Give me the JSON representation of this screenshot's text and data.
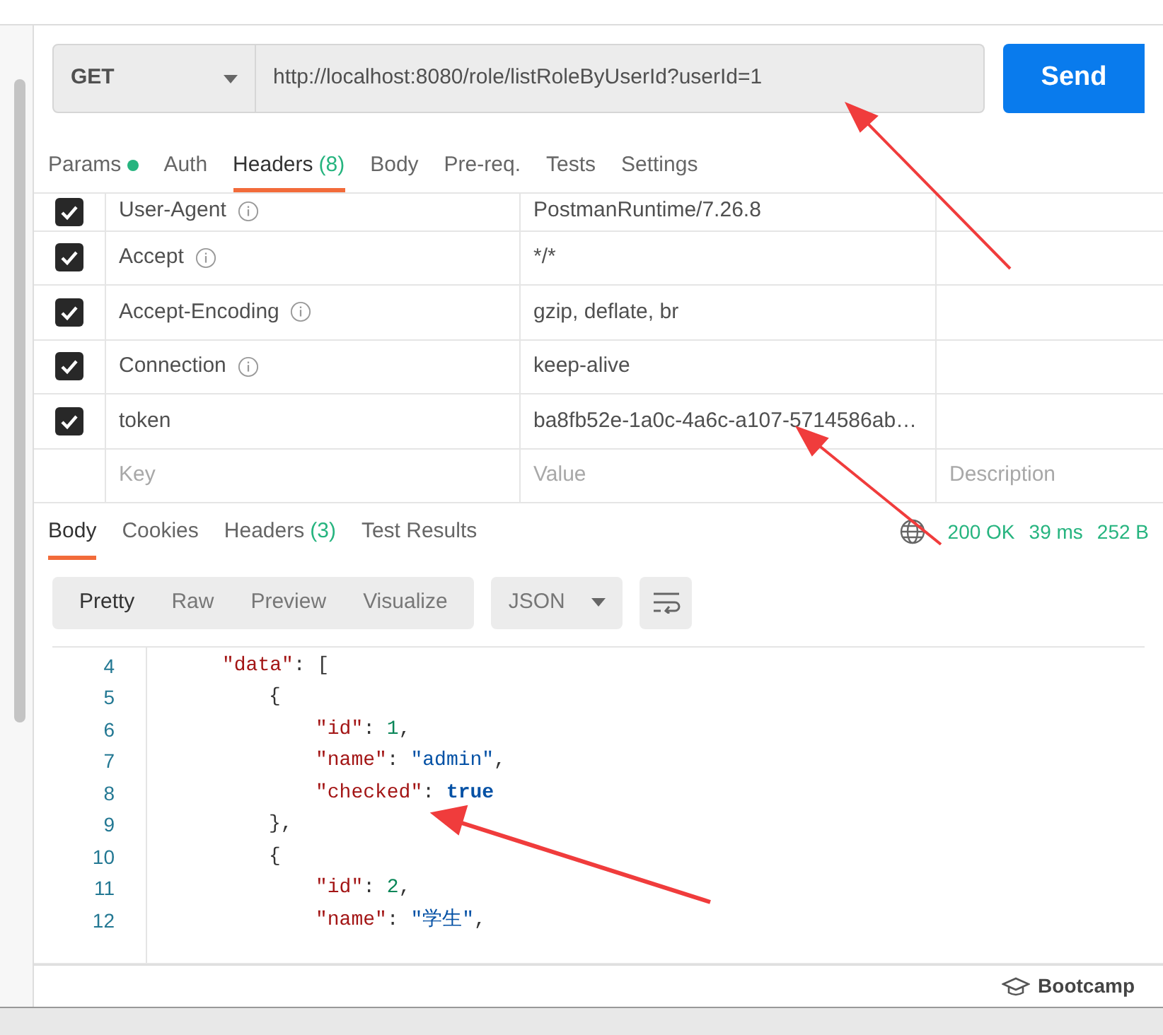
{
  "request": {
    "method": "GET",
    "url": "http://localhost:8080/role/listRoleByUserId?userId=1",
    "send": "Send"
  },
  "request_tabs": [
    {
      "label": "Params",
      "dot": true,
      "selected": false
    },
    {
      "label": "Auth",
      "selected": false
    },
    {
      "label": "Headers",
      "count": "(8)",
      "selected": true
    },
    {
      "label": "Body",
      "selected": false
    },
    {
      "label": "Pre-req.",
      "selected": false
    },
    {
      "label": "Tests",
      "selected": false
    },
    {
      "label": "Settings",
      "selected": false
    }
  ],
  "headers": [
    {
      "key": "User-Agent",
      "value": "PostmanRuntime/7.26.8",
      "checked": true,
      "info": true
    },
    {
      "key": "Accept",
      "value": "*/*",
      "checked": true,
      "info": true
    },
    {
      "key": "Accept-Encoding",
      "value": "gzip, deflate, br",
      "checked": true,
      "info": true
    },
    {
      "key": "Connection",
      "value": "keep-alive",
      "checked": true,
      "info": true
    },
    {
      "key": "token",
      "value": "ba8fb52e-1a0c-4a6c-a107-5714586ab…",
      "checked": true,
      "info": false
    }
  ],
  "new_header": {
    "key_placeholder": "Key",
    "value_placeholder": "Value",
    "description_placeholder": "Description"
  },
  "response_tabs": [
    {
      "label": "Body",
      "selected": true
    },
    {
      "label": "Cookies",
      "selected": false
    },
    {
      "label": "Headers",
      "count": "(3)",
      "selected": false
    },
    {
      "label": "Test Results",
      "selected": false
    }
  ],
  "status": {
    "code": "200 OK",
    "time": "39 ms",
    "size": "252 B"
  },
  "view_modes": [
    {
      "label": "Pretty",
      "selected": true
    },
    {
      "label": "Raw",
      "selected": false
    },
    {
      "label": "Preview",
      "selected": false
    },
    {
      "label": "Visualize",
      "selected": false
    }
  ],
  "format": "JSON",
  "code_lines": [
    {
      "number": "4",
      "tokens": [
        {
          "kind": "key",
          "text": "\"data\""
        },
        {
          "kind": "punct",
          "text": ": ["
        }
      ],
      "children": [
        {
          "number": "5",
          "tokens": [
            {
              "kind": "punct",
              "text": "{"
            }
          ],
          "children": [
            {
              "number": "6",
              "tokens": [
                {
                  "kind": "key",
                  "text": "\"id\""
                },
                {
                  "kind": "punct",
                  "text": ": "
                },
                {
                  "kind": "number",
                  "text": "1"
                },
                {
                  "kind": "punct",
                  "text": ","
                }
              ]
            },
            {
              "number": "7",
              "tokens": [
                {
                  "kind": "key",
                  "text": "\"name\""
                },
                {
                  "kind": "punct",
                  "text": ": "
                },
                {
                  "kind": "string",
                  "text": "\"admin\""
                },
                {
                  "kind": "punct",
                  "text": ","
                }
              ]
            },
            {
              "number": "8",
              "tokens": [
                {
                  "kind": "key",
                  "text": "\"checked\""
                },
                {
                  "kind": "punct",
                  "text": ": "
                },
                {
                  "kind": "bool",
                  "text": "true"
                }
              ]
            }
          ]
        },
        {
          "number": "9",
          "tokens": [
            {
              "kind": "punct",
              "text": "},"
            }
          ]
        },
        {
          "number": "10",
          "tokens": [
            {
              "kind": "punct",
              "text": "{"
            }
          ],
          "children": [
            {
              "number": "11",
              "tokens": [
                {
                  "kind": "key",
                  "text": "\"id\""
                },
                {
                  "kind": "punct",
                  "text": ": "
                },
                {
                  "kind": "number",
                  "text": "2"
                },
                {
                  "kind": "punct",
                  "text": ","
                }
              ]
            },
            {
              "number": "12",
              "tokens": [
                {
                  "kind": "key",
                  "text": "\"name\""
                },
                {
                  "kind": "punct",
                  "text": ": "
                },
                {
                  "kind": "string",
                  "text": "\"学生\""
                },
                {
                  "kind": "punct",
                  "text": ","
                }
              ]
            }
          ]
        }
      ]
    }
  ],
  "footer": {
    "bootcamp": "Bootcamp"
  }
}
